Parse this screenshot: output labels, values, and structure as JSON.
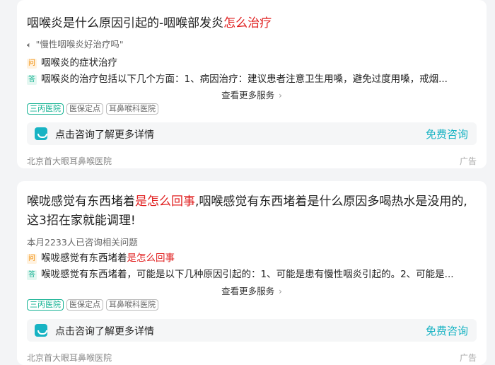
{
  "card1": {
    "title_main": "咽喉炎是什么原因引起的-咽喉部发炎",
    "title_highlight": "怎么治疗",
    "voice_query": "\"慢性咽喉炎好治疗吗\"",
    "question_badge": "问",
    "question_text": "咽喉炎的症状治疗",
    "answer_badge": "答",
    "answer_text": "咽喉炎的治疗包括以下几个方面：1、病因治疗：建议患者注意卫生用嗓，避免过度用嗓，戒烟...",
    "more_label": "查看更多服务",
    "tags": [
      "三丙医院",
      "医保定点",
      "耳鼻喉科医院"
    ],
    "consult_text": "点击咨询了解更多详情",
    "consult_button": "免费咨询",
    "hospital": "北京首大眼耳鼻喉医院",
    "ad_label": "广告"
  },
  "card2": {
    "title_part1": "喉咙感觉有东西堵着",
    "title_highlight": "是怎么回事",
    "title_part2": ",咽喉感觉有东西堵着是什么原因多喝热水是没用的,这3招在家就能调理!",
    "stats": "本月2233人已咨询相关问题",
    "question_badge": "问",
    "question_text": "喉咙感觉有东西堵着",
    "question_highlight": "是怎么回事",
    "answer_badge": "答",
    "answer_text": "喉咙感觉有东西堵着，可能是以下几种原因引起的：1、可能是患有慢性咽炎引起的。2、可能是...",
    "more_label": "查看更多服务",
    "tags": [
      "三丙医院",
      "医保定点",
      "耳鼻喉科医院"
    ],
    "consult_text": "点击咨询了解更多详情",
    "consult_button": "免费咨询",
    "hospital": "北京首大眼耳鼻喉医院",
    "ad_label": "广告"
  }
}
